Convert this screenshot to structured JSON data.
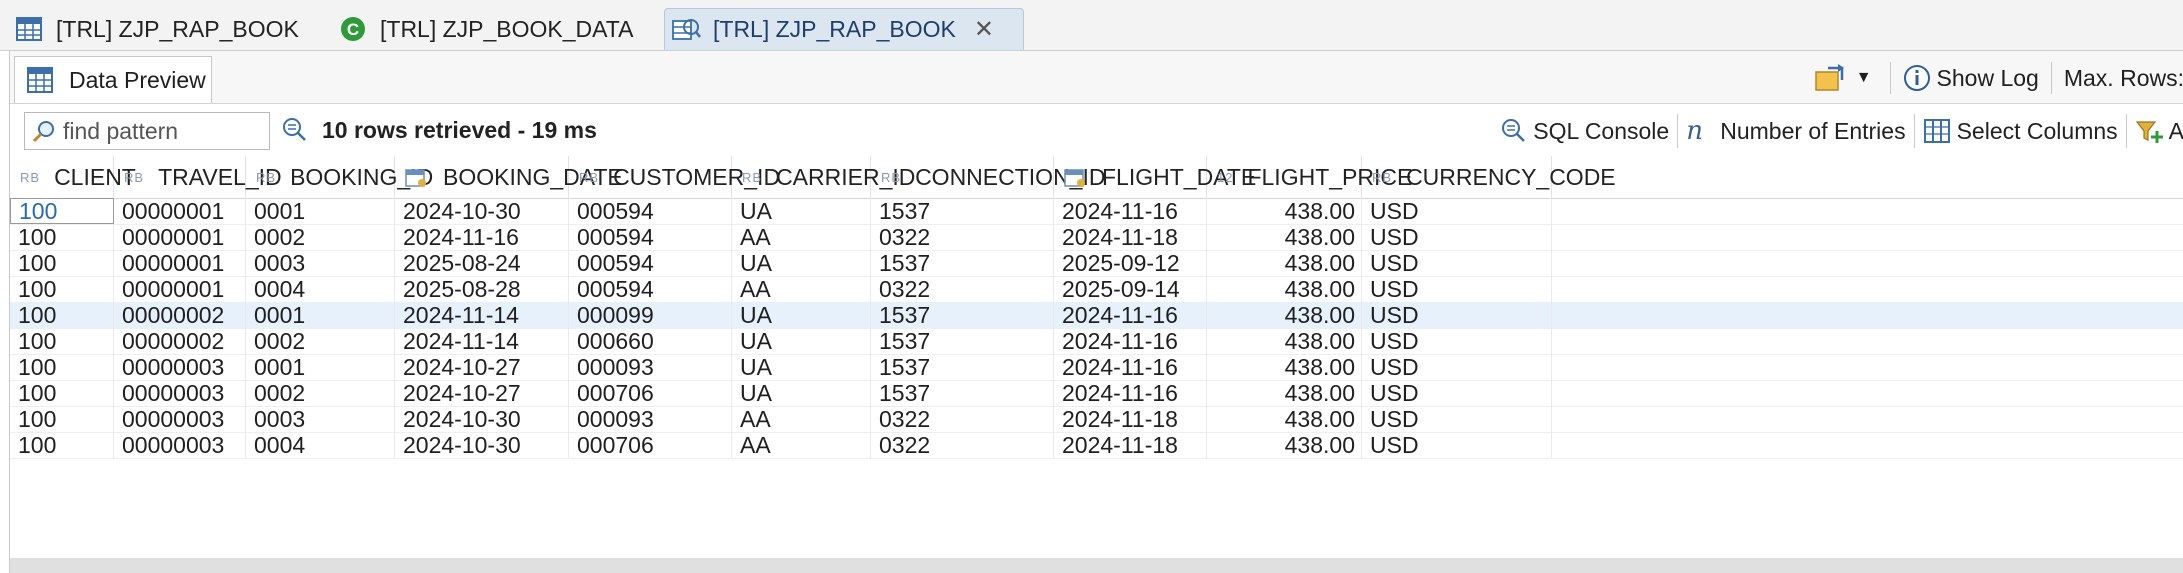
{
  "tabs": [
    {
      "label": "[TRL] ZJP_RAP_BOOK",
      "icon": "table-icon"
    },
    {
      "label": "[TRL] ZJP_BOOK_DATA",
      "icon": "class-icon"
    },
    {
      "label": "[TRL] ZJP_RAP_BOOK",
      "icon": "data-preview-icon",
      "active": true
    }
  ],
  "view": {
    "tab_label": "Data Preview",
    "show_log_label": "Show Log",
    "max_rows_label": "Max. Rows:"
  },
  "filter": {
    "placeholder": "find pattern",
    "rows_info": "10 rows retrieved - 19 ms",
    "sql_console_label": "SQL Console",
    "number_of_entries_label": "Number of Entries",
    "select_columns_label": "Select Columns",
    "add_filter_label": "A"
  },
  "columns": [
    {
      "name": "CLIENT",
      "type": "RB"
    },
    {
      "name": "TRAVEL_ID",
      "type": "RB"
    },
    {
      "name": "BOOKING_ID",
      "type": "RB"
    },
    {
      "name": "BOOKING_DATE",
      "type": "date"
    },
    {
      "name": "CUSTOMER_ID",
      "type": "RB"
    },
    {
      "name": "CARRIER_ID",
      "type": "RB"
    },
    {
      "name": "CONNECTION_ID",
      "type": "RB"
    },
    {
      "name": "FLIGHT_DATE",
      "type": "date"
    },
    {
      "name": "FLIGHT_PRICE",
      "type": "12"
    },
    {
      "name": "CURRENCY_CODE",
      "type": "RB"
    }
  ],
  "rows": [
    [
      "100",
      "00000001",
      "0001",
      "2024-10-30",
      "000594",
      "UA",
      "1537",
      "2024-11-16",
      "438.00",
      "USD"
    ],
    [
      "100",
      "00000001",
      "0002",
      "2024-11-16",
      "000594",
      "AA",
      "0322",
      "2024-11-18",
      "438.00",
      "USD"
    ],
    [
      "100",
      "00000001",
      "0003",
      "2025-08-24",
      "000594",
      "UA",
      "1537",
      "2025-09-12",
      "438.00",
      "USD"
    ],
    [
      "100",
      "00000001",
      "0004",
      "2025-08-28",
      "000594",
      "AA",
      "0322",
      "2025-09-14",
      "438.00",
      "USD"
    ],
    [
      "100",
      "00000002",
      "0001",
      "2024-11-14",
      "000099",
      "UA",
      "1537",
      "2024-11-16",
      "438.00",
      "USD"
    ],
    [
      "100",
      "00000002",
      "0002",
      "2024-11-14",
      "000660",
      "UA",
      "1537",
      "2024-11-16",
      "438.00",
      "USD"
    ],
    [
      "100",
      "00000003",
      "0001",
      "2024-10-27",
      "000093",
      "UA",
      "1537",
      "2024-11-16",
      "438.00",
      "USD"
    ],
    [
      "100",
      "00000003",
      "0002",
      "2024-10-27",
      "000706",
      "UA",
      "1537",
      "2024-11-16",
      "438.00",
      "USD"
    ],
    [
      "100",
      "00000003",
      "0003",
      "2024-10-30",
      "000093",
      "AA",
      "0322",
      "2024-11-18",
      "438.00",
      "USD"
    ],
    [
      "100",
      "00000003",
      "0004",
      "2024-10-30",
      "000706",
      "AA",
      "0322",
      "2024-11-18",
      "438.00",
      "USD"
    ]
  ],
  "selected_row_index": 4,
  "colors": {
    "accent": "#2a6ab3",
    "selected_row": "#e6f1fb",
    "active_tab": "#dbe6f1"
  }
}
